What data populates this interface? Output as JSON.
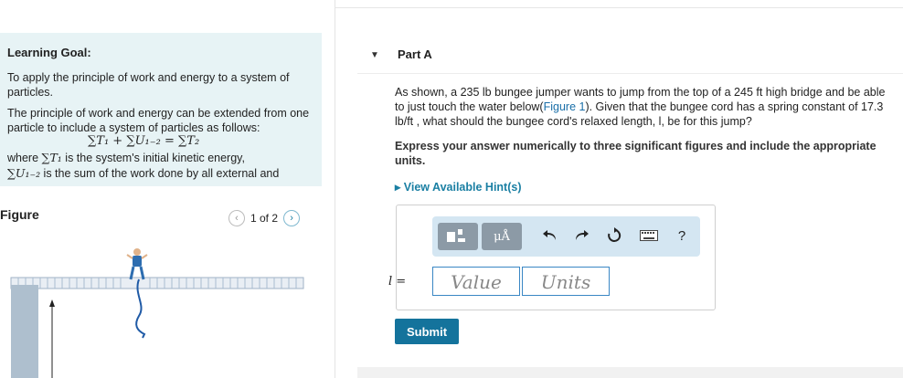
{
  "left": {
    "goal_title": "Learning Goal:",
    "goal_line1": "To apply the principle of work and energy to a system of particles.",
    "goal_line2": "The principle of work and energy can be extended from one particle to include a system of particles as follows:",
    "formula": "∑T₁ + ∑U₁₋₂ = ∑T₂",
    "where1_prefix": "where ",
    "where1_sym": "∑T₁",
    "where1_text": " is the system's initial kinetic energy,",
    "where2_sym": "∑U₁₋₂",
    "where2_text": " is the sum of the work done by all external and"
  },
  "figure": {
    "title": "Figure",
    "pager_text": "1 of 2",
    "prev_icon": "chevron-left-icon",
    "next_icon": "chevron-right-icon"
  },
  "part": {
    "label": "Part A",
    "q_part1": "As shown, a 235 lb bungee jumper wants to jump from the top of a 245 ft high bridge and be able to just touch the water below(",
    "q_link": "Figure 1",
    "q_part2": "). Given that the bungee cord has a spring constant of 17.3 lb/ft , what should the bungee cord's relaxed length, l, be for this jump?",
    "instruction": "Express your answer numerically to three significant figures and include the appropriate units.",
    "hint": "▸ View Available Hint(s)"
  },
  "toolbar": {
    "micro_label": "μÅ",
    "undo_icon": "undo-icon",
    "redo_icon": "redo-icon",
    "reset_icon": "reset-icon",
    "keyboard_icon": "keyboard-icon",
    "help_label": "?"
  },
  "answer": {
    "var_label": "l =",
    "value_placeholder": "Value",
    "units_placeholder": "Units",
    "submit_label": "Submit"
  },
  "colors": {
    "goal_bg": "#e7f3f5",
    "accent": "#14739c",
    "link": "#1a6fa8"
  }
}
